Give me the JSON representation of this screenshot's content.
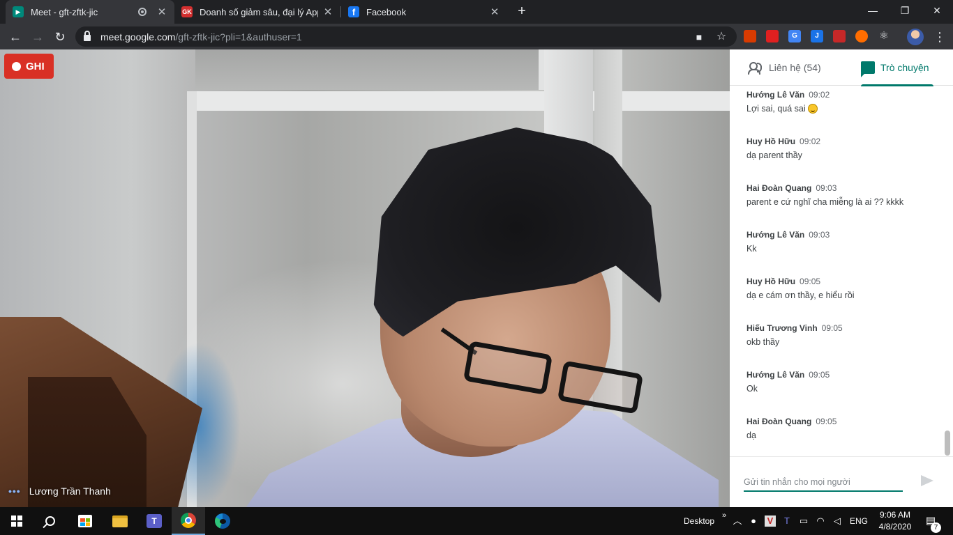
{
  "browser": {
    "tabs": [
      {
        "title": "Meet - gft-zftk-jic",
        "favicon": "google-meet-icon",
        "active": true,
        "recording": true
      },
      {
        "title": "Doanh số giảm sâu, đại lý Apple",
        "favicon": "genk-icon",
        "favicon_text": "GK",
        "active": false
      },
      {
        "title": "Facebook",
        "favicon": "facebook-icon",
        "favicon_text": "f",
        "active": false
      }
    ],
    "close_glyph": "✕",
    "new_tab_glyph": "+",
    "window_controls": {
      "minimize": "—",
      "maximize": "❐",
      "close": "✕"
    },
    "url_host": "meet.google.com",
    "url_path": "/gft-zftk-jic?pli=1&authuser=1",
    "extensions": [
      {
        "name": "office-extension-icon",
        "label": "",
        "color": "#d83b01"
      },
      {
        "name": "adblock-extension-icon",
        "label": "",
        "color": "#e02020"
      },
      {
        "name": "google-translate-extension-icon",
        "label": "G",
        "color": "#4285f4"
      },
      {
        "name": "j-extension-icon",
        "label": "J",
        "color": "#1a73e8"
      },
      {
        "name": "red-book-extension-icon",
        "label": "",
        "color": "#c62828"
      },
      {
        "name": "fire-extension-icon",
        "label": "",
        "color": "#ff6d00"
      },
      {
        "name": "react-devtools-extension-icon",
        "label": "⚛",
        "color": "#35363a"
      }
    ]
  },
  "meeting": {
    "recording_label": "GHI",
    "participant_name": "Lương Trần Thanh",
    "side_tabs": {
      "people": "Liên hệ (54)",
      "chat": "Trò chuyện"
    },
    "messages": [
      {
        "sender": "Hướng Lê Văn",
        "time": "09:02",
        "text": "Lợi sai, quá sai",
        "emoji": true
      },
      {
        "sender": "Huy Hồ Hữu",
        "time": "09:02",
        "text": "dạ parent thầy"
      },
      {
        "sender": "Hai Đoàn Quang",
        "time": "09:03",
        "text": "parent e cứ nghĩ cha miễng là ai ?? kkkk"
      },
      {
        "sender": "Hướng Lê Văn",
        "time": "09:03",
        "text": "Kk"
      },
      {
        "sender": "Huy Hồ Hữu",
        "time": "09:05",
        "text": "dạ e cám ơn thầy, e hiểu rồi"
      },
      {
        "sender": "Hiếu Trương Vinh",
        "time": "09:05",
        "text": "okb thầy"
      },
      {
        "sender": "Hướng Lê Văn",
        "time": "09:05",
        "text": "Ok"
      },
      {
        "sender": "Hai Đoàn Quang",
        "time": "09:05",
        "text": "dạ"
      }
    ],
    "composer_placeholder": "Gửi tin nhắn cho mọi người",
    "accent_color": "#00796b",
    "record_color": "#d93025"
  },
  "taskbar": {
    "desktop_label": "Desktop",
    "language": "ENG",
    "time": "9:06 AM",
    "date": "4/8/2020",
    "notification_count": "7"
  }
}
